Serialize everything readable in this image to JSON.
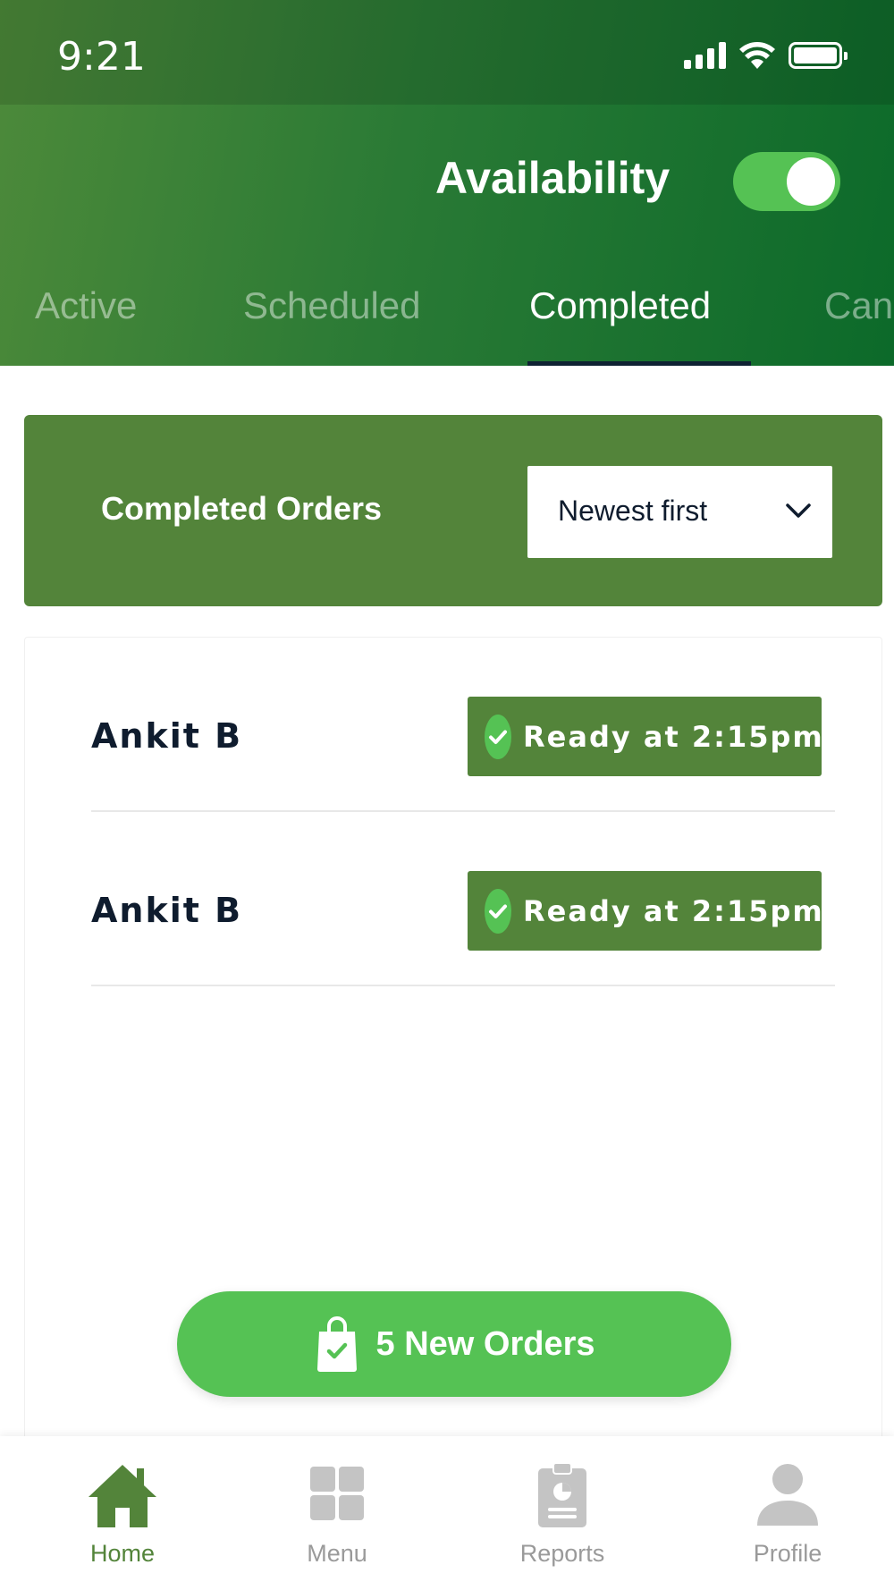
{
  "status_bar": {
    "time": "9:21",
    "icons": [
      "cellular-signal-icon",
      "wifi-icon",
      "battery-icon"
    ]
  },
  "header": {
    "availability_label": "Availability",
    "availability_on": true,
    "tabs": [
      {
        "label": "Active",
        "active": false
      },
      {
        "label": "Scheduled",
        "active": false
      },
      {
        "label": "Completed",
        "active": true
      },
      {
        "label": "Can",
        "active": false
      }
    ]
  },
  "section": {
    "title": "Completed Orders",
    "sort": {
      "selected": "Newest first",
      "icon": "chevron-down-icon"
    }
  },
  "orders": [
    {
      "customer": "Ankit B",
      "status": "Ready at 2:15pm",
      "status_icon": "check-circle-icon"
    },
    {
      "customer": "Ankit B",
      "status": "Ready at 2:15pm",
      "status_icon": "check-circle-icon"
    }
  ],
  "new_orders_button": {
    "label": "5 New Orders",
    "icon": "shopping-bag-check-icon"
  },
  "bottom_nav": {
    "items": [
      {
        "label": "Home",
        "icon": "home-icon",
        "active": true
      },
      {
        "label": "Menu",
        "icon": "grid-icon",
        "active": false
      },
      {
        "label": "Reports",
        "icon": "clipboard-chart-icon",
        "active": false
      },
      {
        "label": "Profile",
        "icon": "person-icon",
        "active": false
      }
    ]
  },
  "colors": {
    "header_gradient_start": "#4d8a3a",
    "header_gradient_end": "#0c6a2a",
    "banner_green": "#53843a",
    "accent_green": "#55c254",
    "text_dark": "#0f1c2e",
    "nav_inactive": "#9a9a9a"
  }
}
